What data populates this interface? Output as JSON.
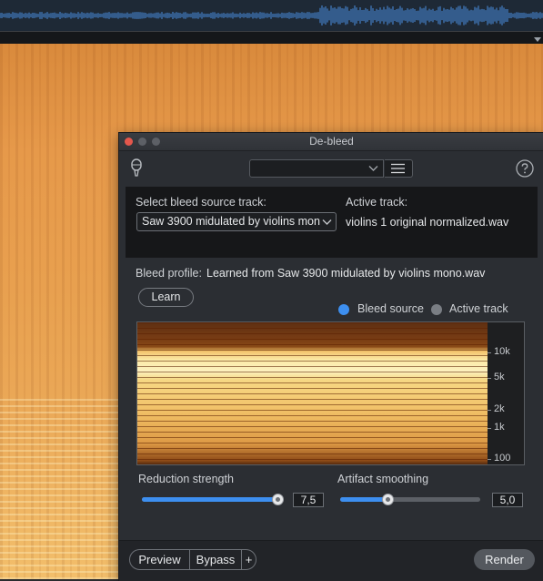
{
  "dialog": {
    "title": "De-bleed",
    "preset_value": "",
    "icons": {
      "mic": "microphone-icon",
      "menu": "hamburger-menu-icon",
      "help": "help-icon"
    }
  },
  "sections": {
    "select_source_label": "Select bleed source track:",
    "source_value": "Saw 3900 midulated by violins mono",
    "active_track_label": "Active track:",
    "active_track_value": "violins 1 original normalized.wav",
    "bleed_profile_label": "Bleed profile:",
    "bleed_profile_value": "Learned from Saw 3900 midulated by violins mono.wav",
    "learn_label": "Learn"
  },
  "view_toggle": {
    "options": [
      {
        "label": "Bleed source",
        "selected": true
      },
      {
        "label": "Active track",
        "selected": false
      }
    ]
  },
  "spectrum": {
    "ticks": [
      "10k",
      "5k",
      "2k",
      "1k",
      "100"
    ]
  },
  "controls": {
    "reduction_label": "Reduction strength",
    "reduction_value": "7,5",
    "reduction_fraction": 0.97,
    "smoothing_label": "Artifact smoothing",
    "smoothing_value": "5,0",
    "smoothing_fraction": 0.34
  },
  "footer": {
    "preview_label": "Preview",
    "bypass_label": "Bypass",
    "add_label": "+",
    "render_label": "Render"
  },
  "colors": {
    "accent": "#3d8ff0",
    "spectrogram": "#e8a04f"
  }
}
